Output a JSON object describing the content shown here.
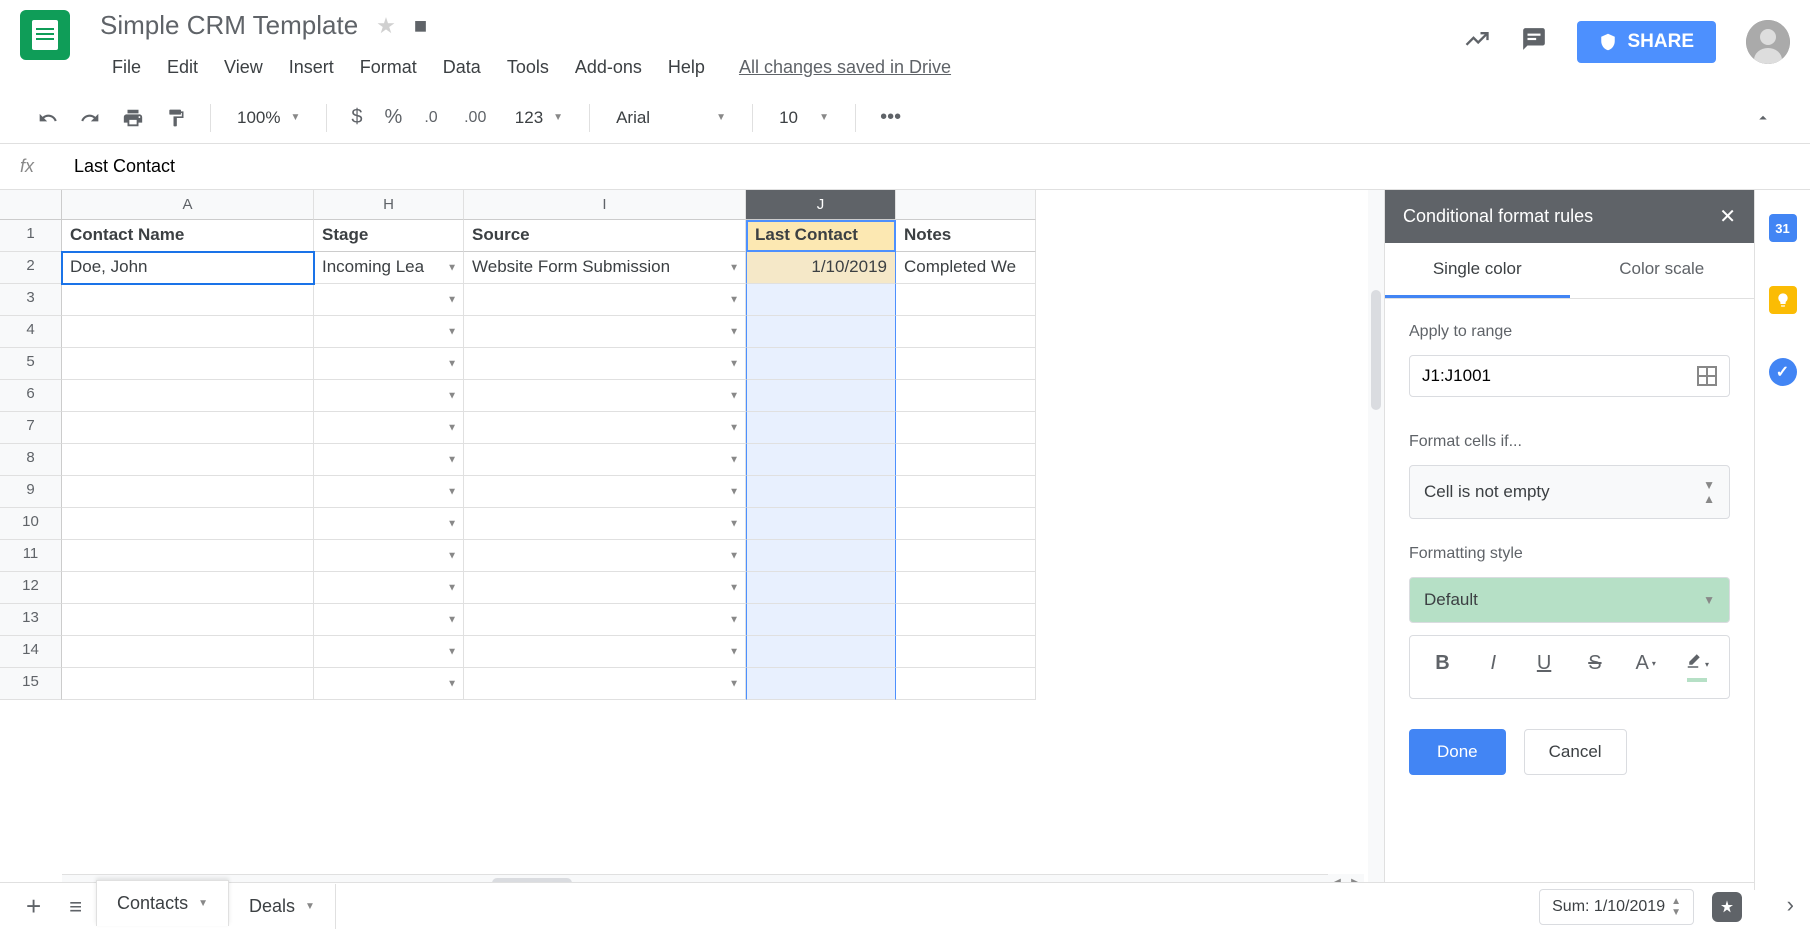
{
  "doc_title": "Simple CRM Template",
  "menubar": [
    "File",
    "Edit",
    "View",
    "Insert",
    "Format",
    "Data",
    "Tools",
    "Add-ons",
    "Help"
  ],
  "drive_status": "All changes saved in Drive",
  "share_label": "SHARE",
  "toolbar": {
    "zoom": "100%",
    "font": "Arial",
    "size": "10"
  },
  "formula_value": "Last Contact",
  "columns": [
    "A",
    "H",
    "I",
    "J",
    ""
  ],
  "selected_col_index": 3,
  "header_row": [
    "Contact Name",
    "Stage",
    "Source",
    "Last Contact",
    "Notes"
  ],
  "data_row": [
    "Doe, John",
    "Incoming Lea",
    "Website Form Submission",
    "1/10/2019",
    "Completed We"
  ],
  "row_count": 15,
  "panel": {
    "title": "Conditional format rules",
    "tabs": [
      "Single color",
      "Color scale"
    ],
    "apply_label": "Apply to range",
    "range_value": "J1:J1001",
    "format_label": "Format cells if...",
    "format_condition": "Cell is not empty",
    "style_label": "Formatting style",
    "style_value": "Default",
    "done": "Done",
    "cancel": "Cancel"
  },
  "sheets": [
    "Contacts",
    "Deals"
  ],
  "active_sheet": 0,
  "sum_label": "Sum: 1/10/2019",
  "rail_calendar": "31"
}
